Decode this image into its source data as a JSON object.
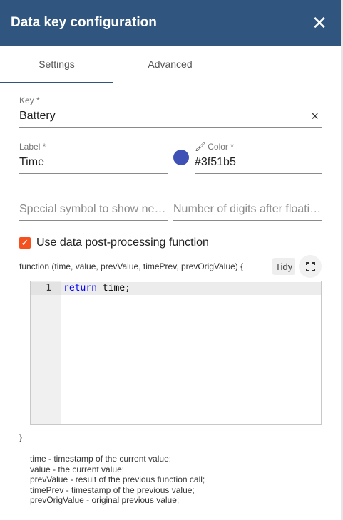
{
  "dialog": {
    "title": "Data key configuration",
    "close_icon": "close-icon"
  },
  "tabs": [
    {
      "label": "Settings",
      "active": true
    },
    {
      "label": "Advanced",
      "active": false
    }
  ],
  "key_field": {
    "label": "Key *",
    "value": "Battery",
    "clear_glyph": "×"
  },
  "label_field": {
    "label": "Label *",
    "value": "Time"
  },
  "color_field": {
    "label": "Color *",
    "value": "#3f51b5",
    "swatch": "#3f51b5",
    "icon": "palette-icon"
  },
  "units_field": {
    "placeholder": "Special symbol to show nex…"
  },
  "decimals_field": {
    "placeholder": "Number of digits after floati…"
  },
  "post_processing": {
    "checked": true,
    "label": "Use data post-processing function",
    "signature": "function (time, value, prevValue, timePrev, prevOrigValue) {",
    "tidy_label": "Tidy",
    "fullscreen_icon": "fullscreen-icon",
    "editor": {
      "line_number": "1",
      "keyword": "return",
      "rest": " time;"
    },
    "closing_brace": "}",
    "help_lines": [
      "time - timestamp of the current value;",
      "value - the current value;",
      "prevValue - result of the previous function call;",
      "timePrev - timestamp of the previous value;",
      "prevOrigValue - original previous value;"
    ]
  },
  "colors": {
    "header": "#305680",
    "checkbox": "#f4511e",
    "keyword": "#0000ff"
  }
}
